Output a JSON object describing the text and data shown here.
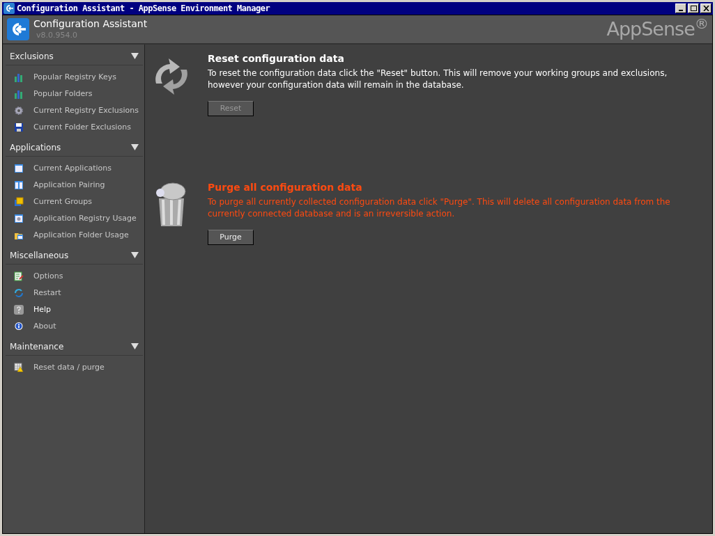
{
  "window": {
    "title": "Configuration Assistant - AppSense Environment Manager"
  },
  "header": {
    "title": "Configuration Assistant",
    "version": "v8.0.954.0",
    "brand": "AppSense$^{®}$"
  },
  "sidebar": {
    "sections": [
      {
        "title": "Exclusions",
        "expanded": true,
        "items": [
          {
            "label": "Popular Registry Keys",
            "kind": "chart",
            "selected": false
          },
          {
            "label": "Popular Folders",
            "kind": "chart",
            "selected": false
          },
          {
            "label": "Current Registry Exclusions",
            "kind": "gear",
            "selected": false
          },
          {
            "label": "Current Folder Exclusions",
            "kind": "disk",
            "selected": false
          }
        ]
      },
      {
        "title": "Applications",
        "expanded": true,
        "items": [
          {
            "label": "Current Applications",
            "kind": "window",
            "selected": false
          },
          {
            "label": "Application Pairing",
            "kind": "split",
            "selected": false
          },
          {
            "label": "Current Groups",
            "kind": "squares",
            "selected": false
          },
          {
            "label": "Application Registry Usage",
            "kind": "windowgear",
            "selected": false
          },
          {
            "label": "Application Folder Usage",
            "kind": "folder",
            "selected": false
          }
        ]
      },
      {
        "title": "Miscellaneous",
        "expanded": true,
        "items": [
          {
            "label": "Options",
            "kind": "edit",
            "selected": false
          },
          {
            "label": "Restart",
            "kind": "refresh",
            "selected": false
          },
          {
            "label": "Help",
            "kind": "help",
            "selected": true
          },
          {
            "label": "About",
            "kind": "info",
            "selected": false
          }
        ]
      },
      {
        "title": "Maintenance",
        "expanded": true,
        "items": [
          {
            "label": "Reset data / purge",
            "kind": "warning",
            "selected": false
          }
        ]
      }
    ]
  },
  "actions": [
    {
      "kind": "reset",
      "title": "Reset configuration data",
      "description": "To reset the configuration data click the \"Reset\" button. This will remove your working groups and exclusions, however your configuration data will remain in the database.",
      "button": {
        "label": "Reset",
        "disabled": true
      }
    },
    {
      "kind": "purge",
      "title": "Purge all configuration data",
      "description": "To purge all currently collected configuration data click \"Purge\". This will delete all configuration data from the currently connected database and is an irreversible action.",
      "button": {
        "label": "Purge",
        "disabled": false
      }
    }
  ]
}
